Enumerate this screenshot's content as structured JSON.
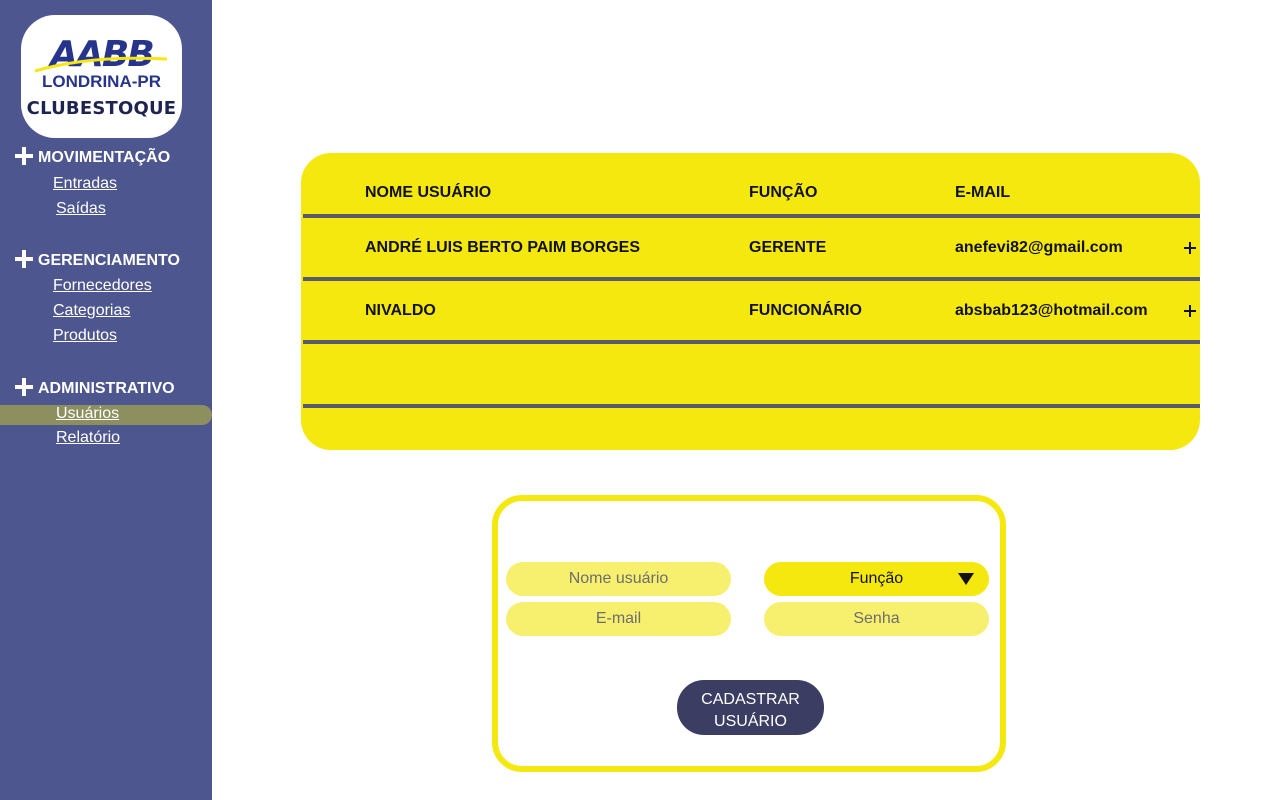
{
  "sidebar": {
    "logo": {
      "brand": "AABB",
      "city": "LONDRINA-PR",
      "app_name": "CLUBESTOQUE"
    },
    "sections": [
      {
        "label": "MOVIMENTAÇÃO",
        "items": [
          "Entradas",
          "Saídas"
        ]
      },
      {
        "label": "GERENCIAMENTO",
        "items": [
          "Fornecedores",
          "Categorias",
          "Produtos"
        ]
      },
      {
        "label": "ADMINISTRATIVO",
        "items": [
          "Usuários",
          "Relatório"
        ]
      }
    ],
    "active_item": "Usuários"
  },
  "users_table": {
    "headers": [
      "NOME USUÁRIO",
      "FUNÇÃO",
      "E-MAIL"
    ],
    "rows": [
      {
        "name": "ANDRÉ LUIS BERTO PAIM BORGES",
        "role": "GERENTE",
        "email": "anefevi82@gmail.com",
        "action_icon": "plus-icon"
      },
      {
        "name": "NIVALDO",
        "role": "FUNCIONÁRIO",
        "email": "absbab123@hotmail.com",
        "action_icon": "plus-icon"
      }
    ]
  },
  "register_form": {
    "name_placeholder": "Nome usuário",
    "role_select": "Função",
    "email_placeholder": "E-mail",
    "password_placeholder": "Senha",
    "submit_line1": "CADASTRAR",
    "submit_line2": "USUÁRIO"
  },
  "colors": {
    "sidebar": "#4d568e",
    "accent_yellow": "#f5e80f",
    "input_yellow": "#f7ef6e",
    "button": "#3b3d63",
    "active_highlight": "#8d8f5f"
  }
}
